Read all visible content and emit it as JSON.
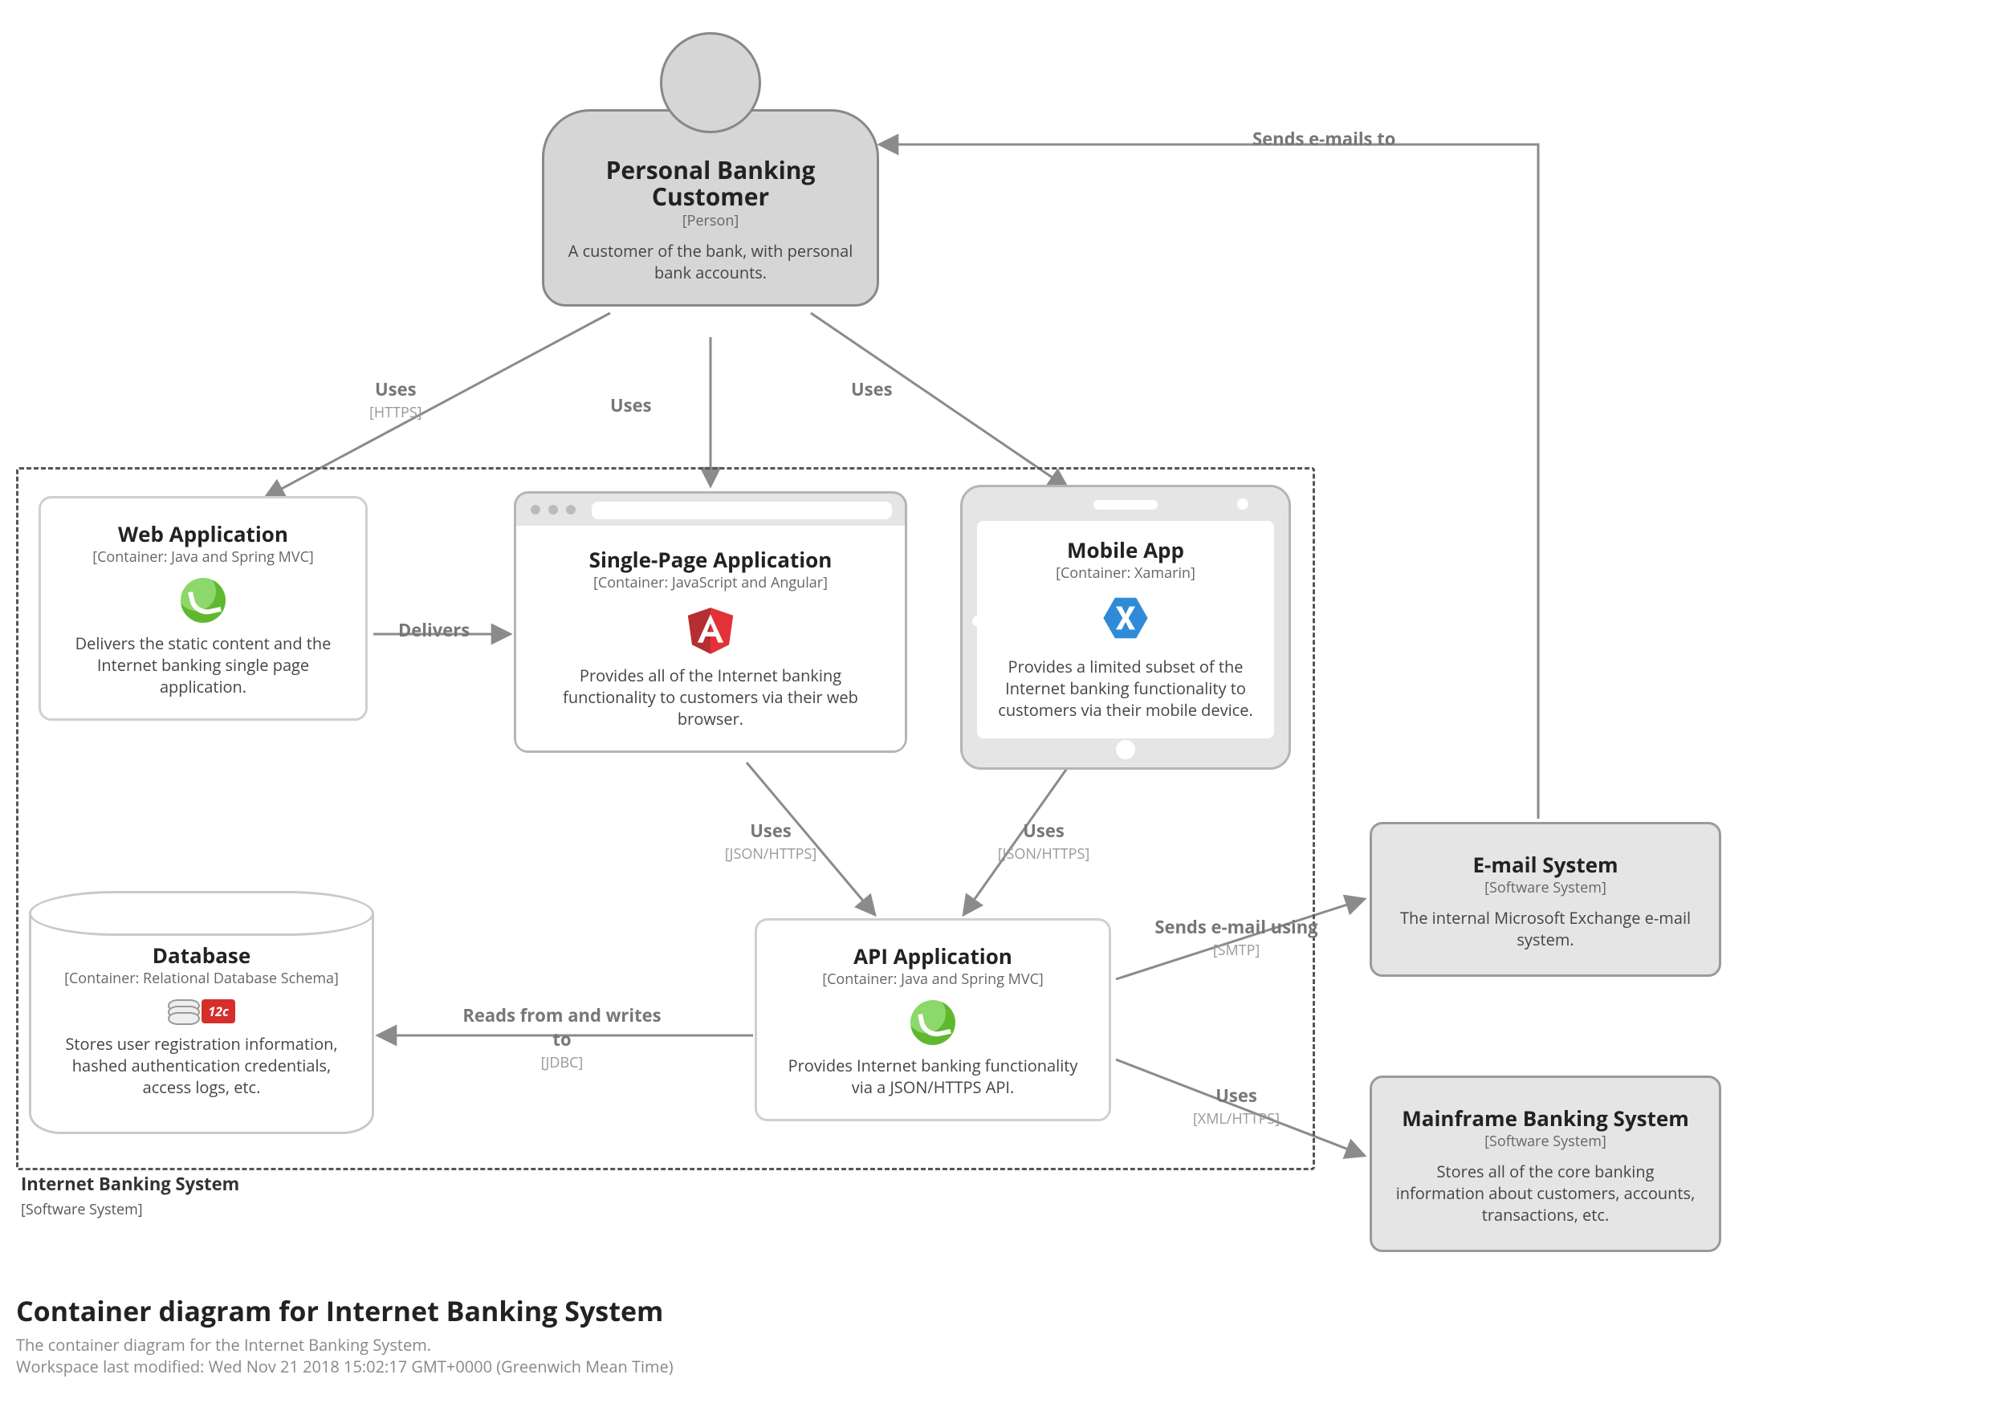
{
  "title": "Container diagram for Internet Banking System",
  "subtitle": "The container diagram for the Internet Banking System.",
  "lastModified": "Workspace last modified: Wed Nov 21 2018 15:02:17 GMT+0000 (Greenwich Mean Time)",
  "boundary": {
    "name": "Internet Banking System",
    "stereotype": "[Software System]"
  },
  "person": {
    "name": "Personal Banking Customer",
    "stereotype": "[Person]",
    "description": "A customer of the bank, with personal bank accounts."
  },
  "containers": {
    "web": {
      "name": "Web Application",
      "stereotype": "[Container: Java and Spring MVC]",
      "description": "Delivers the static content and the Internet banking single page application.",
      "icon": "spring-icon"
    },
    "spa": {
      "name": "Single-Page Application",
      "stereotype": "[Container: JavaScript and Angular]",
      "description": "Provides all of the Internet banking functionality to customers via their web browser.",
      "icon": "angular-icon"
    },
    "mobile": {
      "name": "Mobile App",
      "stereotype": "[Container: Xamarin]",
      "description": "Provides a limited subset of the Internet banking functionality to customers via their mobile device.",
      "icon": "xamarin-icon"
    },
    "api": {
      "name": "API Application",
      "stereotype": "[Container: Java and Spring MVC]",
      "description": "Provides Internet banking functionality via a JSON/HTTPS API.",
      "icon": "spring-icon"
    },
    "db": {
      "name": "Database",
      "stereotype": "[Container: Relational Database Schema]",
      "description": "Stores user registration information, hashed authentication credentials, access logs, etc.",
      "icon": "oracle-icon",
      "iconBadge": "12c"
    }
  },
  "externals": {
    "email": {
      "name": "E-mail System",
      "stereotype": "[Software System]",
      "description": "The internal Microsoft Exchange e-mail system."
    },
    "mainframe": {
      "name": "Mainframe Banking System",
      "stereotype": "[Software System]",
      "description": "Stores all of the core banking information about customers, accounts, transactions, etc."
    }
  },
  "relationships": {
    "person_web": {
      "label": "Uses",
      "tech": "[HTTPS]"
    },
    "person_spa": {
      "label": "Uses",
      "tech": ""
    },
    "person_mobile": {
      "label": "Uses",
      "tech": ""
    },
    "web_spa": {
      "label": "Delivers",
      "tech": ""
    },
    "spa_api": {
      "label": "Uses",
      "tech": "[JSON/HTTPS]"
    },
    "mobile_api": {
      "label": "Uses",
      "tech": "[JSON/HTTPS]"
    },
    "api_db": {
      "label": "Reads from and writes to",
      "tech": "[JDBC]"
    },
    "api_email": {
      "label": "Sends e-mail using",
      "tech": "[SMTP]"
    },
    "api_mainframe": {
      "label": "Uses",
      "tech": "[XML/HTTPS]"
    },
    "email_person": {
      "label": "Sends e-mails to",
      "tech": ""
    }
  }
}
